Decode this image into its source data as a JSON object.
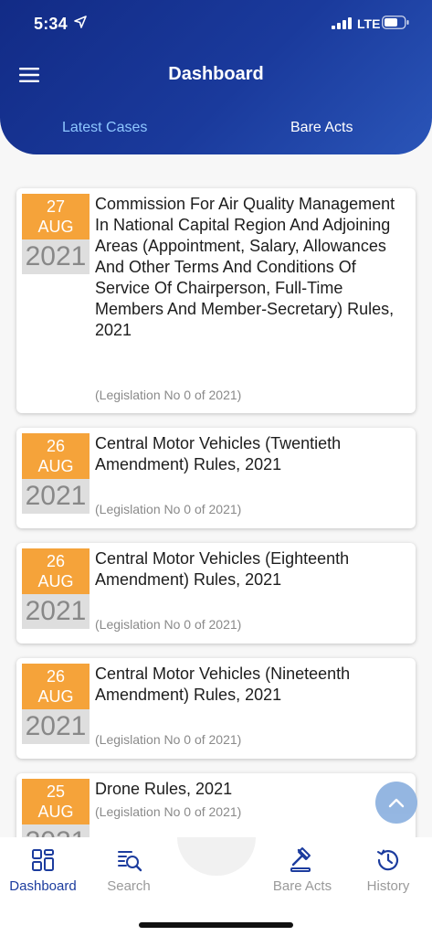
{
  "status": {
    "time": "5:34",
    "network": "LTE"
  },
  "header": {
    "title": "Dashboard",
    "tabs": [
      "Latest Cases",
      "Bare Acts"
    ]
  },
  "cases": [
    {
      "day": "27",
      "month": "AUG",
      "year": "2021",
      "title": "Commission For Air Quality Management In National Capital Region And Adjoining Areas (Appointment, Salary, Allowances And Other Terms And Conditions Of Service Of Chairperson, Full-Time Members And Member-Secretary) Rules, 2021",
      "subtitle": "(Legislation No 0 of 2021)"
    },
    {
      "day": "26",
      "month": "AUG",
      "year": "2021",
      "title": "Central Motor Vehicles (Twentieth Amendment) Rules, 2021",
      "subtitle": "(Legislation No 0 of 2021)"
    },
    {
      "day": "26",
      "month": "AUG",
      "year": "2021",
      "title": "Central Motor Vehicles (Eighteenth Amendment) Rules, 2021",
      "subtitle": "(Legislation No 0 of 2021)"
    },
    {
      "day": "26",
      "month": "AUG",
      "year": "2021",
      "title": "Central Motor Vehicles (Nineteenth Amendment) Rules, 2021",
      "subtitle": "(Legislation No 0 of 2021)"
    },
    {
      "day": "25",
      "month": "AUG",
      "year": "2021",
      "title": "Drone Rules, 2021",
      "subtitle": "(Legislation No 0 of 2021)"
    }
  ],
  "nav": [
    {
      "label": "Dashboard",
      "icon": "dashboard-icon",
      "active": true
    },
    {
      "label": "Search",
      "icon": "search-doc-icon",
      "active": false
    },
    {
      "label": "Bare Acts",
      "icon": "gavel-icon",
      "active": false
    },
    {
      "label": "History",
      "icon": "history-icon",
      "active": false
    }
  ],
  "colors": {
    "header": "#1a3a9c",
    "date_badge": "#f5a33a",
    "active_nav": "#1c3c9e"
  }
}
